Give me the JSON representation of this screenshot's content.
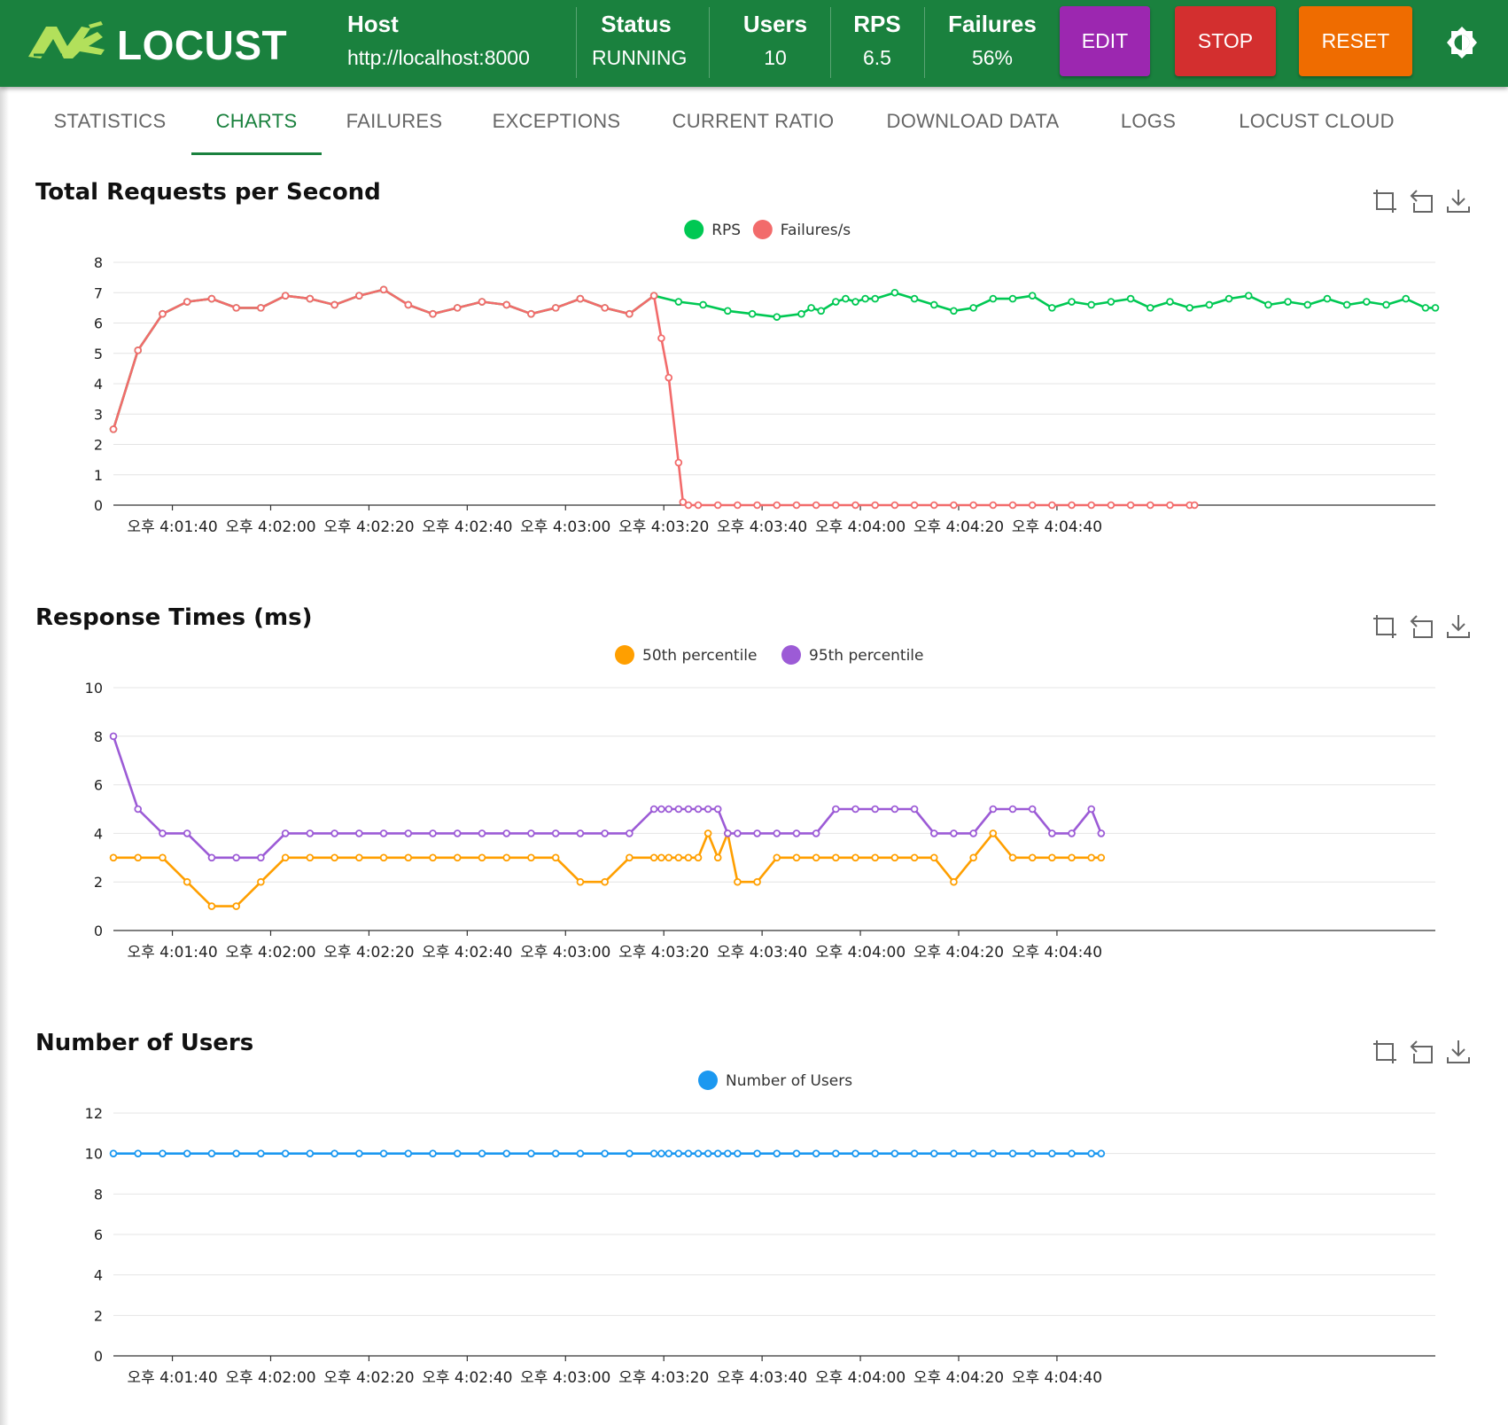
{
  "app": {
    "name": "LOCUST",
    "theme_toggle_icon": "brightness-icon",
    "colors": {
      "header": "#1a813e",
      "edit": "#9c27b0",
      "stop": "#d32f2f",
      "reset": "#ef6c00"
    }
  },
  "header": {
    "host_label": "Host",
    "host_value": "http://localhost:8000",
    "status_label": "Status",
    "status_value": "RUNNING",
    "users_label": "Users",
    "users_value": "10",
    "rps_label": "RPS",
    "rps_value": "6.5",
    "failures_label": "Failures",
    "failures_value": "56%",
    "edit_label": "EDIT",
    "stop_label": "STOP",
    "reset_label": "RESET"
  },
  "tabs": [
    {
      "label": "STATISTICS"
    },
    {
      "label": "CHARTS",
      "active": true
    },
    {
      "label": "FAILURES"
    },
    {
      "label": "EXCEPTIONS"
    },
    {
      "label": "CURRENT RATIO"
    },
    {
      "label": "DOWNLOAD DATA"
    },
    {
      "label": "LOGS"
    },
    {
      "label": "LOCUST CLOUD"
    }
  ],
  "toolbox_icons": [
    "zoom-icon",
    "zoom-reset-icon",
    "download-icon"
  ],
  "chart_data": [
    {
      "type": "line",
      "title": "Total Requests per Second",
      "xlabel": "",
      "ylabel": "",
      "ylim": [
        0,
        8
      ],
      "yticks": [
        "0",
        "1",
        "2",
        "3",
        "4",
        "5",
        "6",
        "7",
        "8"
      ],
      "xticks": [
        "오후 4:01:40",
        "오후 4:02:00",
        "오후 4:02:20",
        "오후 4:02:40",
        "오후 4:03:00",
        "오후 4:03:20",
        "오후 4:03:40",
        "오후 4:04:00",
        "오후 4:04:20",
        "오후 4:04:40"
      ],
      "grid": true,
      "legend": "top-center",
      "series": [
        {
          "name": "RPS",
          "color": "#00c853",
          "x": [
            28,
            33,
            38,
            43,
            48,
            53,
            58,
            63,
            68,
            73,
            78,
            83,
            88,
            93,
            98,
            103,
            108,
            113,
            118,
            123,
            128,
            133,
            138,
            143,
            148,
            153,
            158,
            163,
            168,
            170,
            172,
            175,
            177,
            179,
            181,
            183,
            187,
            191,
            195,
            199,
            203,
            207,
            211,
            215,
            219,
            223,
            227,
            231,
            235,
            239,
            243,
            247,
            251,
            255,
            259,
            263,
            267,
            271,
            275,
            279,
            283,
            287,
            291,
            295,
            297
          ],
          "values": [
            2.5,
            5.1,
            6.3,
            6.7,
            6.8,
            6.5,
            6.5,
            6.9,
            6.8,
            6.6,
            6.9,
            7.1,
            6.6,
            6.3,
            6.5,
            6.7,
            6.6,
            6.3,
            6.5,
            6.8,
            6.5,
            6.3,
            6.9,
            6.7,
            6.6,
            6.4,
            6.3,
            6.2,
            6.3,
            6.5,
            6.4,
            6.7,
            6.8,
            6.7,
            6.8,
            6.8,
            7.0,
            6.8,
            6.6,
            6.4,
            6.5,
            6.8,
            6.8,
            6.9,
            6.5,
            6.7,
            6.6,
            6.7,
            6.8,
            6.5,
            6.7,
            6.5,
            6.6,
            6.8,
            6.9,
            6.6,
            6.7,
            6.6,
            6.8,
            6.6,
            6.7,
            6.6,
            6.8,
            6.5,
            6.5
          ]
        },
        {
          "name": "Failures/s",
          "color": "#f26b6b",
          "x": [
            28,
            33,
            38,
            43,
            48,
            53,
            58,
            63,
            68,
            73,
            78,
            83,
            88,
            93,
            98,
            103,
            108,
            113,
            118,
            123,
            128,
            133,
            138,
            139.5,
            141,
            143,
            143.9,
            145,
            147,
            151,
            155,
            159,
            163,
            167,
            171,
            175,
            179,
            183,
            187,
            191,
            195,
            199,
            203,
            207,
            211,
            215,
            219,
            223,
            227,
            231,
            235,
            239,
            243,
            247,
            248
          ],
          "values": [
            2.5,
            5.1,
            6.3,
            6.7,
            6.8,
            6.5,
            6.5,
            6.9,
            6.8,
            6.6,
            6.9,
            7.1,
            6.6,
            6.3,
            6.5,
            6.7,
            6.6,
            6.3,
            6.5,
            6.8,
            6.5,
            6.3,
            6.9,
            5.5,
            4.2,
            1.4,
            0.1,
            0,
            0,
            0,
            0,
            0,
            0,
            0,
            0,
            0,
            0,
            0,
            0,
            0,
            0,
            0,
            0,
            0,
            0,
            0,
            0,
            0,
            0,
            0,
            0,
            0,
            0,
            0,
            0
          ]
        }
      ]
    },
    {
      "type": "line",
      "title": "Response Times (ms)",
      "xlabel": "",
      "ylabel": "",
      "ylim": [
        0,
        10
      ],
      "yticks": [
        "0",
        "2",
        "4",
        "6",
        "8",
        "10"
      ],
      "xticks": [
        "오후 4:01:40",
        "오후 4:02:00",
        "오후 4:02:20",
        "오후 4:02:40",
        "오후 4:03:00",
        "오후 4:03:20",
        "오후 4:03:40",
        "오후 4:04:00",
        "오후 4:04:20",
        "오후 4:04:40"
      ],
      "grid": true,
      "legend": "top-center",
      "series": [
        {
          "name": "50th percentile",
          "color": "#ff9f00",
          "values": [
            3,
            3,
            3,
            2,
            1,
            1,
            2,
            3,
            3,
            3,
            3,
            3,
            3,
            3,
            3,
            3,
            3,
            3,
            3,
            2,
            2,
            3,
            3,
            3,
            3,
            3,
            3,
            3,
            4,
            3,
            4,
            2,
            2,
            3,
            3,
            3,
            3,
            3,
            3,
            3,
            3,
            3,
            2,
            3,
            4,
            3,
            3,
            3,
            3,
            3,
            3
          ]
        },
        {
          "name": "95th percentile",
          "color": "#9c5bd6",
          "values": [
            8,
            5,
            4,
            4,
            3,
            3,
            3,
            4,
            4,
            4,
            4,
            4,
            4,
            4,
            4,
            4,
            4,
            4,
            4,
            4,
            4,
            4,
            5,
            5,
            5,
            5,
            5,
            5,
            5,
            5,
            4,
            4,
            4,
            4,
            4,
            4,
            5,
            5,
            5,
            5,
            5,
            4,
            4,
            4,
            5,
            5,
            5,
            4,
            4,
            5,
            4
          ]
        }
      ]
    },
    {
      "type": "line",
      "title": "Number of Users",
      "xlabel": "",
      "ylabel": "",
      "ylim": [
        0,
        12
      ],
      "yticks": [
        "0",
        "2",
        "4",
        "6",
        "8",
        "10",
        "12"
      ],
      "xticks": [
        "오후 4:01:40",
        "오후 4:02:00",
        "오후 4:02:20",
        "오후 4:02:40",
        "오후 4:03:00",
        "오후 4:03:20",
        "오후 4:03:40",
        "오후 4:04:00",
        "오후 4:04:20",
        "오후 4:04:40"
      ],
      "grid": true,
      "legend": "top-center",
      "series": [
        {
          "name": "Number of Users",
          "color": "#1b98f0",
          "values": [
            10,
            10,
            10,
            10,
            10,
            10,
            10,
            10,
            10,
            10,
            10,
            10,
            10,
            10,
            10,
            10,
            10,
            10,
            10,
            10,
            10,
            10,
            10,
            10,
            10,
            10,
            10,
            10,
            10,
            10,
            10,
            10,
            10,
            10,
            10,
            10,
            10,
            10,
            10,
            10,
            10,
            10,
            10,
            10,
            10,
            10,
            10,
            10,
            10,
            10,
            10
          ]
        }
      ]
    }
  ]
}
